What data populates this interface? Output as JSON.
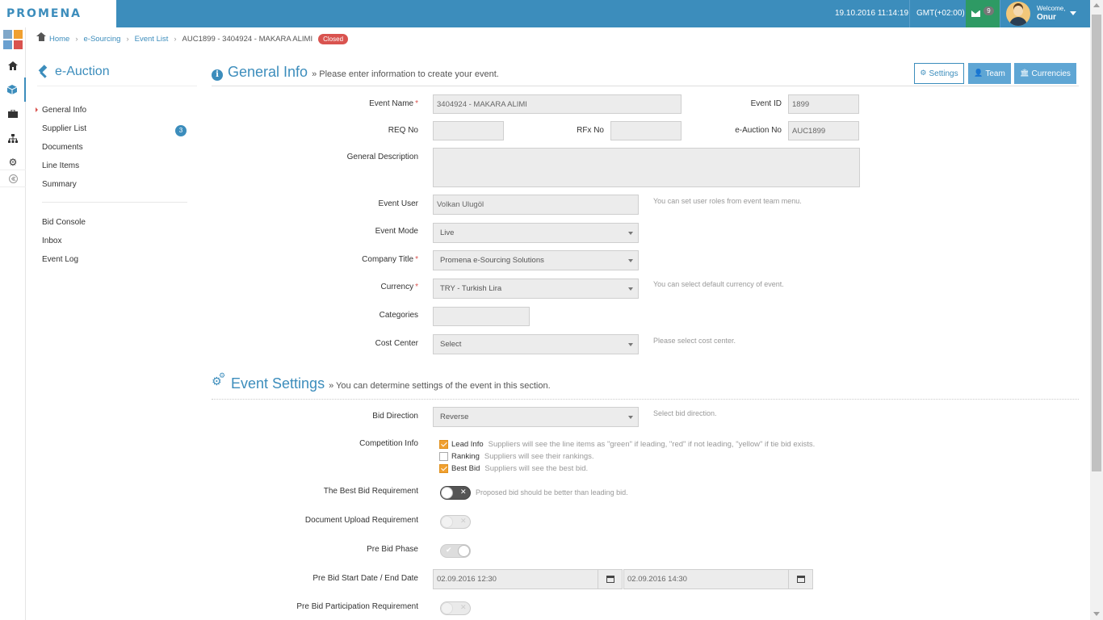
{
  "header": {
    "logo": "PROMENA",
    "datetime": "19.10.2016 11:14:19",
    "timezone": "GMT(+02:00)",
    "mail_count": "9",
    "welcome": "Welcome,",
    "user_name": "Onur",
    "colors": {
      "bar": "#3c8dbc",
      "mail": "#2e9a64"
    }
  },
  "rail": {
    "icons": [
      "home-icon",
      "cube-icon",
      "briefcase-icon",
      "sitemap-icon",
      "gear-icon",
      "collapse-icon"
    ]
  },
  "breadcrumb": {
    "items": [
      "Home",
      "e-Sourcing",
      "Event List"
    ],
    "current": "AUC1899 - 3404924 - MAKARA ALIMI",
    "status": "Closed"
  },
  "subnav": {
    "title": "e-Auction",
    "items": [
      {
        "label": "General Info"
      },
      {
        "label": "Supplier List",
        "badge": "3"
      },
      {
        "label": "Documents"
      },
      {
        "label": "Line Items"
      },
      {
        "label": "Summary"
      }
    ],
    "items2": [
      {
        "label": "Bid Console"
      },
      {
        "label": "Inbox"
      },
      {
        "label": "Event Log"
      }
    ]
  },
  "general": {
    "title": "General Info",
    "subtitle": "» Please enter information to create your event.",
    "buttons": {
      "settings": "Settings",
      "team": "Team",
      "currencies": "Currencies"
    },
    "event_name": {
      "label": "Event Name",
      "value": "3404924 - MAKARA ALIMI"
    },
    "event_id": {
      "label": "Event ID",
      "value": "1899"
    },
    "req_no": {
      "label": "REQ No",
      "value": ""
    },
    "rfx_no": {
      "label": "RFx No",
      "value": ""
    },
    "eauction_no": {
      "label": "e-Auction No",
      "value": "AUC1899"
    },
    "description": {
      "label": "General Description",
      "value": ""
    },
    "event_user": {
      "label": "Event User",
      "value": "Volkan Ulugöl",
      "help": "You can set user roles from event team menu."
    },
    "event_mode": {
      "label": "Event Mode",
      "value": "Live"
    },
    "company": {
      "label": "Company Title",
      "value": "Promena e-Sourcing Solutions"
    },
    "currency": {
      "label": "Currency",
      "value": "TRY - Turkish Lira",
      "help": "You can select default currency of event."
    },
    "categories": {
      "label": "Categories",
      "value": ""
    },
    "cost_center": {
      "label": "Cost Center",
      "value": "Select",
      "help": "Please select cost center."
    }
  },
  "settings": {
    "title": "Event Settings",
    "subtitle": "» You can determine settings of the event in this section.",
    "bid_direction": {
      "label": "Bid Direction",
      "value": "Reverse",
      "help": "Select bid direction."
    },
    "competition": {
      "label": "Competition Info",
      "options": [
        {
          "name": "Lead Info",
          "desc": "Suppliers will see the line items as \"green\" if leading, \"red\" if not leading, \"yellow\" if tie bid exists.",
          "checked": true
        },
        {
          "name": "Ranking",
          "desc": "Suppliers will see their rankings.",
          "checked": false
        },
        {
          "name": "Best Bid",
          "desc": "Suppliers will see the best bid.",
          "checked": true
        }
      ]
    },
    "best_bid_req": {
      "label": "The Best Bid Requirement",
      "help": "Proposed bid should be better than leading bid."
    },
    "doc_upload": {
      "label": "Document Upload Requirement"
    },
    "pre_bid": {
      "label": "Pre Bid Phase"
    },
    "pre_bid_dates": {
      "label": "Pre Bid Start Date / End Date",
      "start": "02.09.2016 12:30",
      "end": "02.09.2016 14:30"
    },
    "pre_bid_participation": {
      "label": "Pre Bid Participation Requirement"
    }
  }
}
